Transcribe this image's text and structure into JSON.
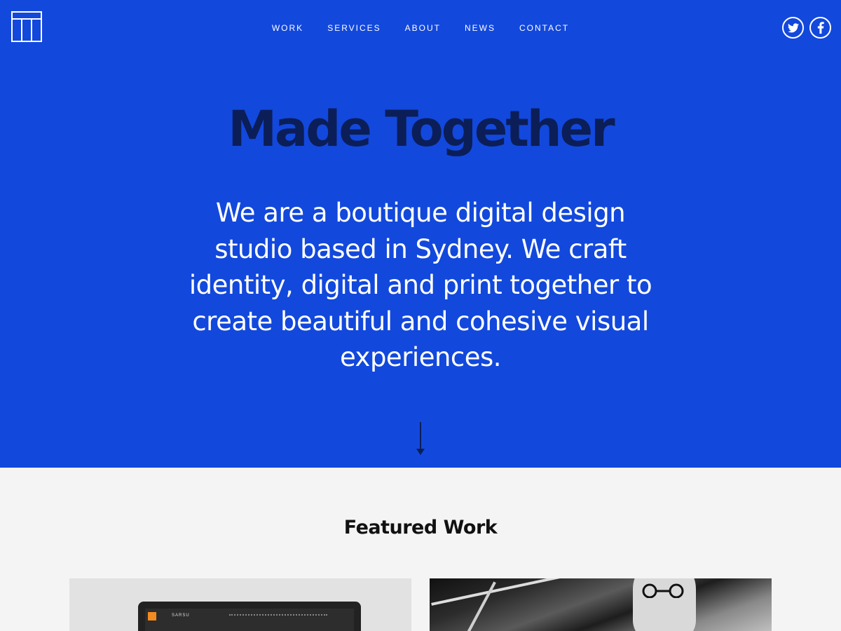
{
  "nav": {
    "items": [
      "WORK",
      "SERVICES",
      "ABOUT",
      "NEWS",
      "CONTACT"
    ]
  },
  "social": {
    "twitter_icon": "twitter-icon",
    "facebook_icon": "facebook-icon"
  },
  "hero": {
    "headline": "Made Together",
    "intro": "We are a boutique digital design studio based in Sydney. We craft identity, digital and print together to create beautiful and cohesive visual experiences.",
    "scroll_icon": "arrow-down-icon"
  },
  "featured": {
    "title": "Featured Work",
    "cards": [
      {
        "brand": "SARSU"
      }
    ]
  },
  "colors": {
    "hero_bg": "#1248dc",
    "headline": "#0b1e57",
    "section_bg": "#f4f4f4"
  }
}
